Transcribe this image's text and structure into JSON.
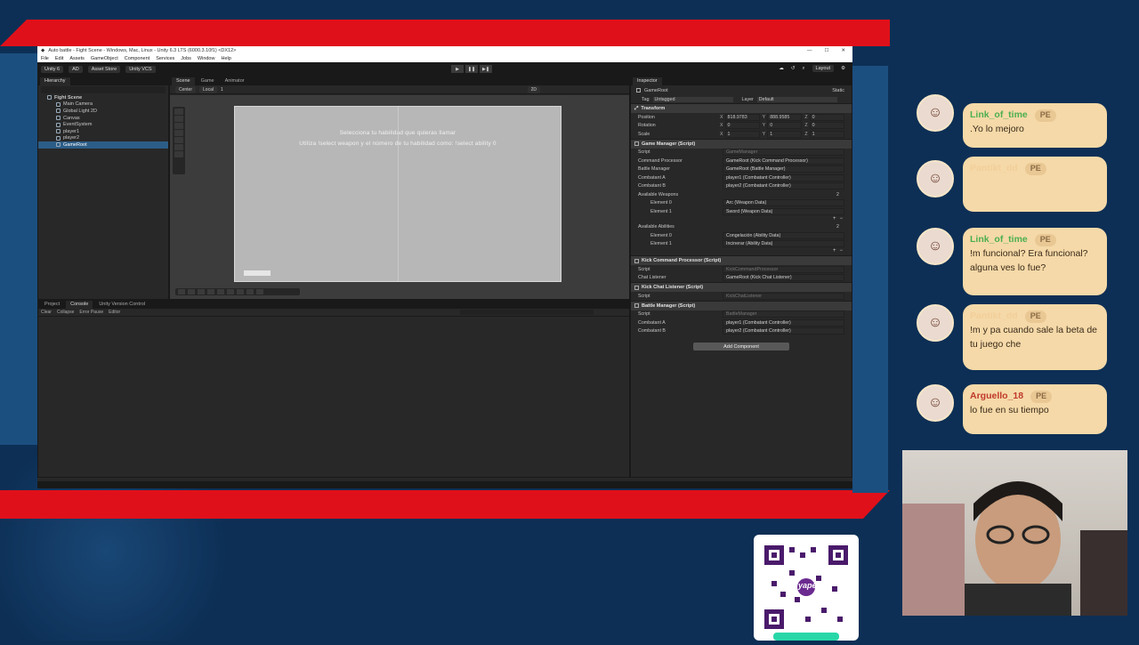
{
  "window": {
    "title": "Auto battle - Fight Scene - Windows, Mac, Linux - Unity 6.3 LTS (6000.3.10f1) <DX12>",
    "menu": [
      "File",
      "Edit",
      "Assets",
      "GameObject",
      "Component",
      "Services",
      "Jobs",
      "Window",
      "Help"
    ]
  },
  "toolbar": {
    "account": "Unity 6",
    "user": "AD",
    "asset_store": "Asset Store",
    "vcs": "Unity VCS",
    "layout": "Layout"
  },
  "hierarchy": {
    "tab": "Hierarchy",
    "scene": "Fight Scene",
    "items": [
      "Main Camera",
      "Global Light 2D",
      "Canvas",
      "EventSystem",
      "player1",
      "player2",
      "GameRoot"
    ],
    "selected": "GameRoot"
  },
  "scene_tabs": [
    "Scene",
    "Game",
    "Animator"
  ],
  "scene_tools": {
    "pivot": "Center",
    "space": "Local",
    "snap": "1",
    "mode": "2D"
  },
  "canvas": {
    "line1": "Selecciona tu habilidad que quieras llamar",
    "line2": "Utiliza !select weapon y el número de tu habilidad como: !select ability 0"
  },
  "bottom_tabs": [
    "Project",
    "Console",
    "Unity Version Control"
  ],
  "console_bar": [
    "Clear",
    "Collapse",
    "Error Pause",
    "Editor"
  ],
  "inspector": {
    "tab": "Inspector",
    "object_name": "GameRoot",
    "static_label": "Static",
    "tag_label": "Tag",
    "tag": "Untagged",
    "layer_label": "Layer",
    "layer": "Default",
    "transform": {
      "title": "Transform",
      "position_label": "Position",
      "rotation_label": "Rotation",
      "scale_label": "Scale",
      "position": [
        "818.9783",
        "888.9585",
        "0"
      ],
      "rotation": [
        "0",
        "0",
        "0"
      ],
      "scale": [
        "1",
        "1",
        "1"
      ]
    },
    "game_manager": {
      "title": "Game Manager (Script)",
      "script_label": "Script",
      "script": "GameManager",
      "command_processor_label": "Command Processor",
      "command_processor": "GameRoot (Kick Command Processor)",
      "battle_manager_label": "Battle Manager",
      "battle_manager": "GameRoot (Battle Manager)",
      "combatant_a_label": "Combatant A",
      "combatant_a": "player1 (Combatant Controller)",
      "combatant_b_label": "Combatant B",
      "combatant_b": "player2 (Combatant Controller)",
      "weapons_label": "Available Weapons",
      "weapons_count": "2",
      "weapons": [
        {
          "label": "Element 0",
          "value": "Arc (Weapon Data)"
        },
        {
          "label": "Element 1",
          "value": "Sword (Weapon Data)"
        }
      ],
      "abilities_label": "Available Abilities",
      "abilities_count": "2",
      "abilities": [
        {
          "label": "Element 0",
          "value": "Congelación (Ability Data)"
        },
        {
          "label": "Element 1",
          "value": "Incinerar (Ability Data)"
        }
      ]
    },
    "kick_command": {
      "title": "Kick Command Processor (Script)",
      "script_label": "Script",
      "script": "KickCommandProcessor",
      "listener_label": "Chat Listener",
      "listener": "GameRoot (Kick Chat Listener)"
    },
    "kick_chat": {
      "title": "Kick Chat Listener (Script)",
      "script_label": "Script",
      "script": "KickChatListener"
    },
    "battle_manager": {
      "title": "Battle Manager (Script)",
      "script_label": "Script",
      "script": "BattleManager",
      "combatant_a_label": "Combatant A",
      "combatant_a": "player1 (Combatant Controller)",
      "combatant_b_label": "Combatant B",
      "combatant_b": "player2 (Combatant Controller)"
    },
    "add_component": "Add Component"
  },
  "chat": [
    {
      "name": "Link_of_time",
      "badge": "PE",
      "text": ".Yo lo mejoro",
      "name_color": "#4caf50"
    },
    {
      "name": "Pantikt_dd",
      "badge": "PE",
      "text": "",
      "name_color": "#f2cf9a"
    },
    {
      "name": "Link_of_time",
      "badge": "PE",
      "text": "!m funcional? Era funcional? alguna ves lo fue?",
      "name_color": "#4caf50"
    },
    {
      "name": "Pantikt_dd",
      "badge": "PE",
      "text": "!m y pa cuando sale la beta de tu juego che",
      "name_color": "#f2cf9a"
    },
    {
      "name": "Arguello_18",
      "badge": "PE",
      "text": "lo fue en su tiempo",
      "name_color": "#c0392b"
    }
  ],
  "qr_brand": "yape"
}
